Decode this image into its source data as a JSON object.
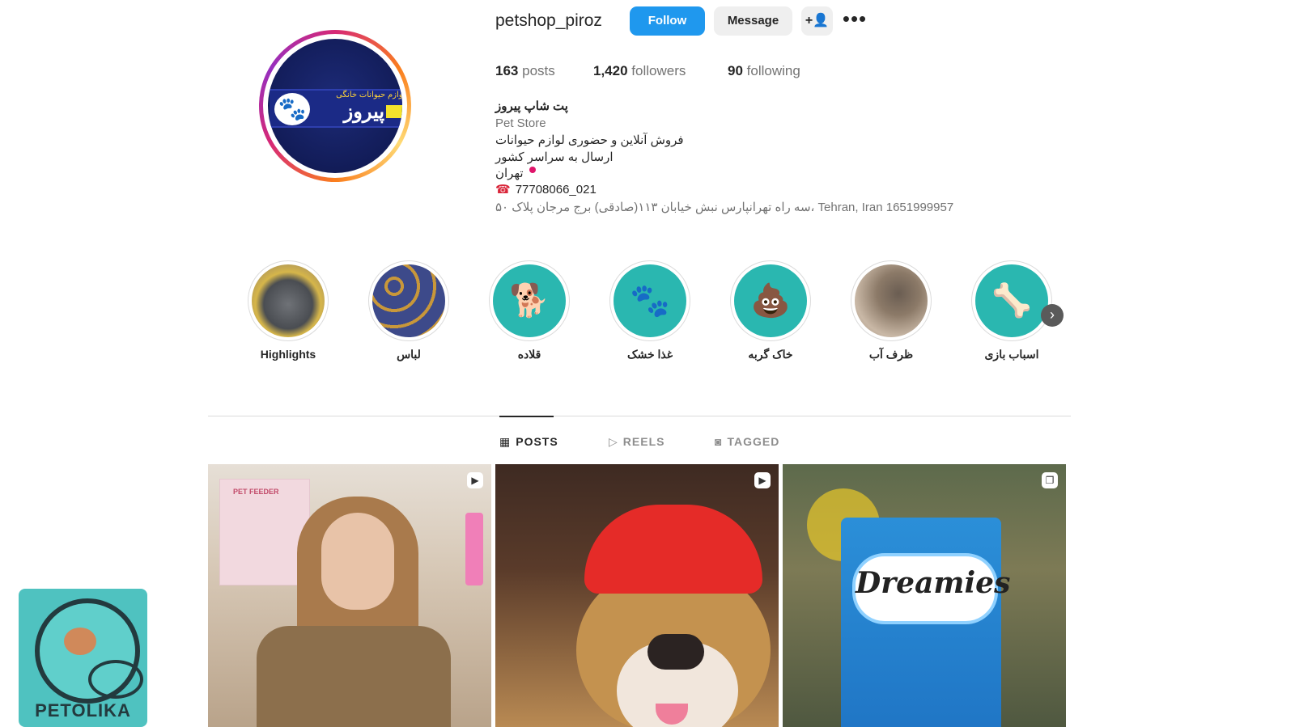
{
  "profile": {
    "username": "petshop_piroz",
    "avatar_text_small": "لوازم حیوانات خانگی",
    "avatar_text_big": "پیروز"
  },
  "actions": {
    "follow": "Follow",
    "message": "Message",
    "add_user_icon": "+👤",
    "more_icon": "•••"
  },
  "stats": {
    "posts_count": "163",
    "posts_label": "posts",
    "followers_count": "1,420",
    "followers_label": "followers",
    "following_count": "90",
    "following_label": "following"
  },
  "bio": {
    "name": "پت شاپ پیروز",
    "category": "Pet Store",
    "line1": "فروش آنلاین و حضوری لوازم حیوانات",
    "line2": "ارسال به سراسر کشور",
    "line3": "تهران",
    "phone_icon": "☎",
    "phone": "77708066_021",
    "address": "سه راه تهرانپارس نبش خیابان ۱۱۳(صادقی) برج مرجان پلاک ۵۰، Tehran, Iran 1651999957"
  },
  "highlights": [
    {
      "label": "Highlights"
    },
    {
      "label": "لباس"
    },
    {
      "label": "قلاده",
      "glyph": "🐕"
    },
    {
      "label": "غذا خشک",
      "glyph": "🐾"
    },
    {
      "label": "خاک گربه",
      "glyph": "💩"
    },
    {
      "label": "ظرف آب"
    },
    {
      "label": "اسباب بازی",
      "glyph": "🦴"
    }
  ],
  "highlights_next_icon": "›",
  "tabs": [
    {
      "label": "POSTS",
      "icon": "▦",
      "active": true
    },
    {
      "label": "REELS",
      "icon": "▷",
      "active": false
    },
    {
      "label": "TAGGED",
      "icon": "◙",
      "active": false
    }
  ],
  "posts": [
    {
      "type_icon": "▶",
      "box_text": "PET FEEDER"
    },
    {
      "type_icon": "▶"
    },
    {
      "type_icon": "❐",
      "product_text": "Dreamies"
    }
  ],
  "overlay_logo": {
    "text": "PETOLIKA"
  }
}
